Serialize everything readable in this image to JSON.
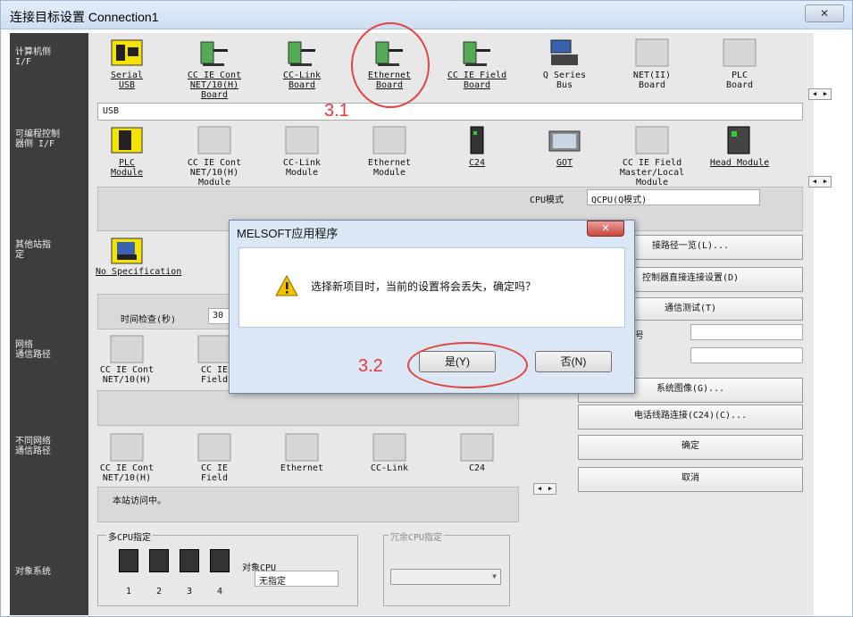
{
  "window": {
    "title": "连接目标设置 Connection1",
    "close": "✕"
  },
  "sections": {
    "pc_if": "计算机侧\nI/F",
    "plc_if": "可编程控制\n器侧 I/F",
    "other_station": "其他站指\n定",
    "network_route": "网络\n通信路径",
    "diff_network": "不同网络\n通信路径",
    "target_system": "对象系统"
  },
  "pc_if_items": [
    {
      "label": "Serial\nUSB",
      "icon": "serial-usb-icon"
    },
    {
      "label": "CC IE Cont\nNET/10(H)\nBoard",
      "icon": "board-icon"
    },
    {
      "label": "CC-Link\nBoard",
      "icon": "board-icon"
    },
    {
      "label": "Ethernet\nBoard",
      "icon": "ethernet-board-icon"
    },
    {
      "label": "CC IE Field\nBoard",
      "icon": "board-icon"
    },
    {
      "label": "Q Series\nBus",
      "icon": "bus-icon"
    },
    {
      "label": "NET(II)\nBoard",
      "icon": "blank-icon"
    },
    {
      "label": "PLC\nBoard",
      "icon": "blank-icon"
    }
  ],
  "pc_if_value": "USB",
  "plc_if_items": [
    {
      "label": "PLC\nModule",
      "icon": "plc-module-icon"
    },
    {
      "label": "CC IE Cont\nNET/10(H)\nModule",
      "icon": "blank-icon"
    },
    {
      "label": "CC-Link\nModule",
      "icon": "blank-icon"
    },
    {
      "label": "Ethernet\nModule",
      "icon": "blank-icon"
    },
    {
      "label": "C24",
      "icon": "c24-icon"
    },
    {
      "label": "GOT",
      "icon": "got-icon"
    },
    {
      "label": "CC IE Field\nMaster/Local\nModule",
      "icon": "blank-icon"
    },
    {
      "label": "Head Module",
      "icon": "head-module-icon"
    }
  ],
  "cpu_mode_label": "CPU模式",
  "cpu_mode_value": "QCPU(Q模式)",
  "other_station": {
    "label": "No Specification",
    "time_check_label": "时间检查(秒)",
    "time_check_value": "30"
  },
  "network_items": [
    {
      "label": "CC IE Cont\nNET/10(H)"
    },
    {
      "label": "CC IE\nField"
    }
  ],
  "diff_network_items": [
    {
      "label": "CC IE Cont\nNET/10(H)"
    },
    {
      "label": "CC IE\nField"
    },
    {
      "label": "Ethernet"
    },
    {
      "label": "CC-Link"
    },
    {
      "label": "C24"
    }
  ],
  "station_text": "本站访问中。",
  "right_buttons": [
    "接路径一览(L)...",
    "控制器直接连接设置(D)",
    "通信测试(T)",
    "系统图像(G)...",
    "电话线路连接(C24)(C)...",
    "确定",
    "取消"
  ],
  "right_label": "号",
  "multi_cpu": {
    "title": "多CPU指定",
    "target_label": "对象CPU",
    "target_value": "无指定",
    "nums": [
      "1",
      "2",
      "3",
      "4"
    ]
  },
  "redundant_cpu": {
    "title": "冗余CPU指定"
  },
  "annotations": {
    "a1": "3.1",
    "a2": "3.2"
  },
  "dialog": {
    "title": "MELSOFT应用程序",
    "close": "✕",
    "message": "选择新项目时，当前的设置将会丢失，确定吗？",
    "yes": "是(Y)",
    "no": "否(N)"
  }
}
